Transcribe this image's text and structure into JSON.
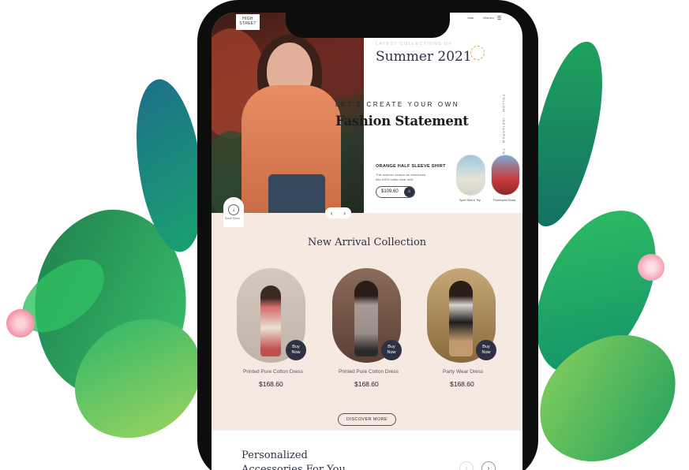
{
  "header": {
    "logo_line1": "HIGH",
    "logo_line2": "STREET",
    "nav_links": [
      "Man",
      "Women"
    ],
    "menu_icon": "hamburger-icon"
  },
  "hero": {
    "eyebrow": "LATEST COLLECTIONS OF",
    "headline": "Summer 2021",
    "sun_icon": "sun-icon",
    "tagline": "LET'S CREATE YOUR OWN",
    "statement": "Fashion Statement",
    "vertical_text": "FOLLOW · INSTAGRAM · TWITTER",
    "product": {
      "title": "ORANGE HALF SLEEVE SHIRT",
      "description": "This summer season we introduced this 100% cotton bear shirt",
      "price": "$109.60",
      "cart_icon": "cart-icon"
    },
    "thumbnails": [
      {
        "label": "Sport Skirt & Top"
      },
      {
        "label": "Flowerprint Dress"
      }
    ],
    "scroll_label": "Scroll Down",
    "prev_arrow": "‹",
    "next_arrow": "›"
  },
  "arrivals": {
    "title": "New Arrival Collection",
    "cards": [
      {
        "name": "Printed Pure Cotton Dress",
        "price": "$168.60",
        "buy_line1": "Buy",
        "buy_line2": "Now"
      },
      {
        "name": "Printed Pure Cotton Dress",
        "price": "$168.60",
        "buy_line1": "Buy",
        "buy_line2": "Now"
      },
      {
        "name": "Party Wear Dress",
        "price": "$168.60",
        "buy_line1": "Buy",
        "buy_line2": "Now"
      }
    ],
    "discover_label": "DISCOVER MORE"
  },
  "accessories": {
    "title_line1": "Personalized",
    "title_line2": "Accessories For You",
    "prev_icon": "‹",
    "next_icon": "›"
  },
  "colors": {
    "brand_dark": "#2d3142",
    "section_bg": "#f6e9e2",
    "leaf_green": "#1fa35b",
    "leaf_teal": "#14776b",
    "flower_pink": "#f6a9b8"
  }
}
